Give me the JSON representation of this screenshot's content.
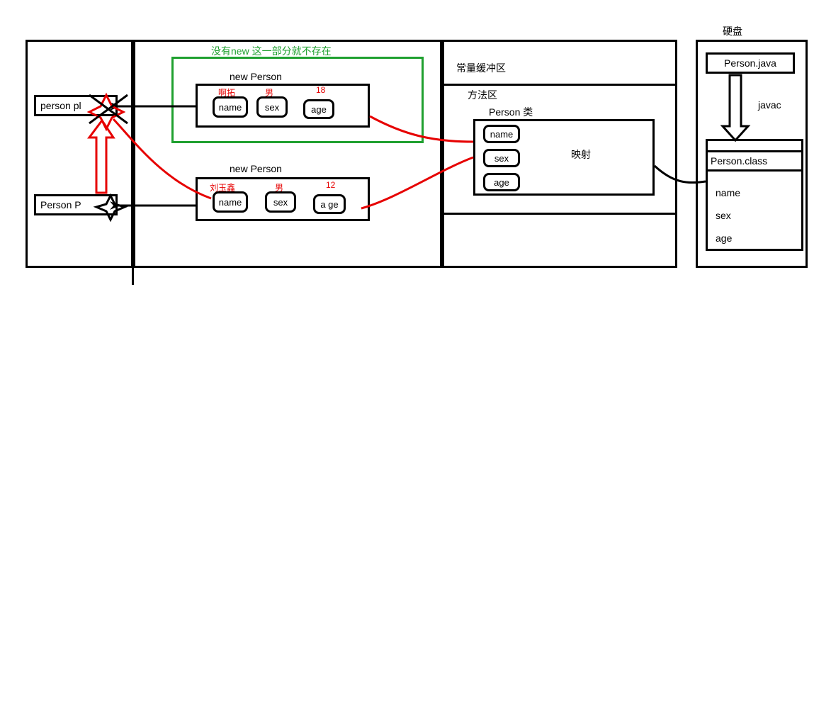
{
  "disk": {
    "title": "硬盘",
    "file_java": "Person.java",
    "compile_label": "javac",
    "file_class": "Person.class",
    "fields": {
      "name": "name",
      "sex": "sex",
      "age": "age"
    }
  },
  "memory": {
    "stack": {
      "var1": "person pl",
      "var2": "Person P"
    },
    "heap": {
      "green_note": "没有new 这一部分就不存在",
      "obj1": {
        "title": "new Person",
        "name_label": "name",
        "sex_label": "sex",
        "age_label": "age",
        "name_value": "啊拓",
        "sex_value": "男",
        "age_value": "18"
      },
      "obj2": {
        "title": "new Person",
        "name_label": "name",
        "sex_label": "sex",
        "age_label": "a ge",
        "name_value": "刘玉鑫",
        "sex_value": "男",
        "age_value": "12"
      }
    },
    "method_area": {
      "constant_pool": "常量缓冲区",
      "title": "方法区",
      "class_name": "Person 类",
      "mapping": "映射",
      "fields": {
        "name": "name",
        "sex": "sex",
        "age": "age"
      }
    }
  }
}
